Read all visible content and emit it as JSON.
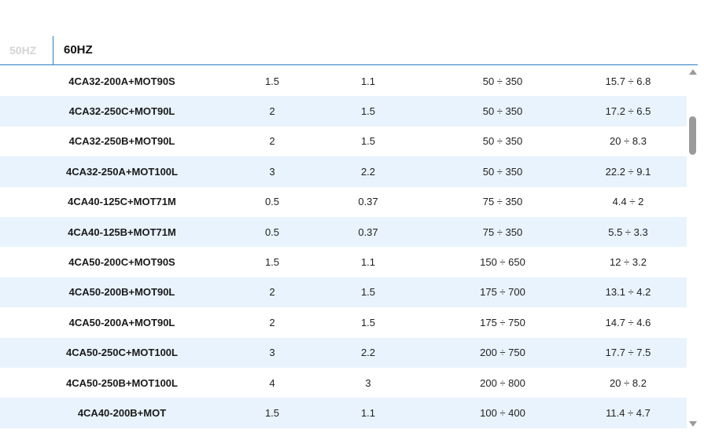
{
  "tabs": {
    "hz50": "50HZ",
    "hz60": "60HZ",
    "active": "60HZ"
  },
  "table": {
    "rows": [
      {
        "model": "4CA32-200A+MOT90S",
        "c1": "1.5",
        "c2": "1.1",
        "c3": "50 ÷ 350",
        "c4": "15.7 ÷ 6.8"
      },
      {
        "model": "4CA32-250C+MOT90L",
        "c1": "2",
        "c2": "1.5",
        "c3": "50 ÷ 350",
        "c4": "17.2 ÷ 6.5"
      },
      {
        "model": "4CA32-250B+MOT90L",
        "c1": "2",
        "c2": "1.5",
        "c3": "50 ÷ 350",
        "c4": "20 ÷ 8.3"
      },
      {
        "model": "4CA32-250A+MOT100L",
        "c1": "3",
        "c2": "2.2",
        "c3": "50 ÷ 350",
        "c4": "22.2 ÷ 9.1"
      },
      {
        "model": "4CA40-125C+MOT71M",
        "c1": "0.5",
        "c2": "0.37",
        "c3": "75 ÷ 350",
        "c4": "4.4 ÷ 2"
      },
      {
        "model": "4CA40-125B+MOT71M",
        "c1": "0.5",
        "c2": "0.37",
        "c3": "75 ÷ 350",
        "c4": "5.5 ÷ 3.3"
      },
      {
        "model": "4CA50-200C+MOT90S",
        "c1": "1.5",
        "c2": "1.1",
        "c3": "150 ÷ 650",
        "c4": "12 ÷ 3.2"
      },
      {
        "model": "4CA50-200B+MOT90L",
        "c1": "2",
        "c2": "1.5",
        "c3": "175 ÷ 700",
        "c4": "13.1 ÷ 4.2"
      },
      {
        "model": "4CA50-200A+MOT90L",
        "c1": "2",
        "c2": "1.5",
        "c3": "175 ÷ 750",
        "c4": "14.7 ÷ 4.6"
      },
      {
        "model": "4CA50-250C+MOT100L",
        "c1": "3",
        "c2": "2.2",
        "c3": "200 ÷ 750",
        "c4": "17.7 ÷ 7.5"
      },
      {
        "model": "4CA50-250B+MOT100L",
        "c1": "4",
        "c2": "3",
        "c3": "200 ÷ 800",
        "c4": "20 ÷ 8.2"
      },
      {
        "model": "4CA40-200B+MOT",
        "c1": "1.5",
        "c2": "1.1",
        "c3": "100 ÷ 400",
        "c4": "11.4 ÷ 4.7"
      }
    ]
  },
  "colors": {
    "accent": "#2a7fc0",
    "row_alt": "#e8f3fd",
    "inactive_tab": "#d4d4d4"
  }
}
